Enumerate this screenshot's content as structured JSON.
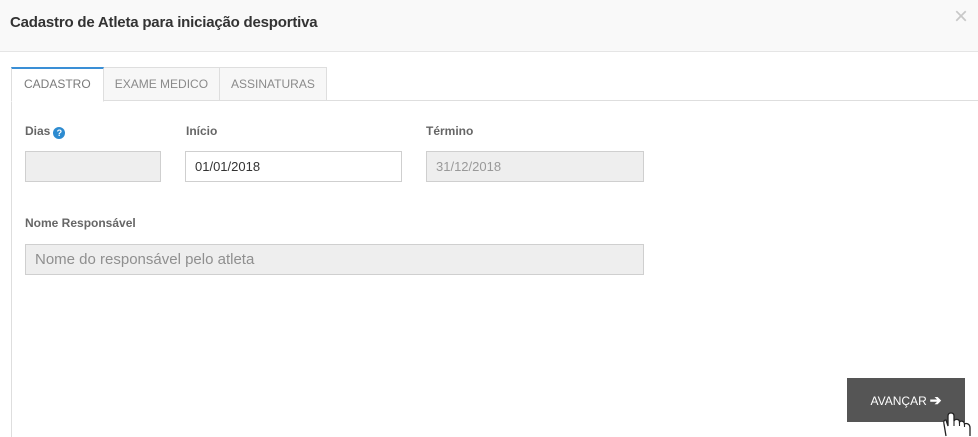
{
  "modal": {
    "title": "Cadastro de Atleta para iniciação desportiva",
    "close_symbol": "×"
  },
  "tabs": [
    {
      "label": "CADASTRO",
      "active": true
    },
    {
      "label": "EXAME MEDICO",
      "active": false
    },
    {
      "label": "ASSINATURAS",
      "active": false
    }
  ],
  "form": {
    "dias": {
      "label": "Dias",
      "value": "",
      "help_icon": "question-circle-icon",
      "help_symbol": "?"
    },
    "inicio": {
      "label": "Início",
      "value": "01/01/2018"
    },
    "termino": {
      "label": "Término",
      "value": "31/12/2018"
    },
    "responsavel": {
      "label": "Nome Responsável",
      "value": "",
      "placeholder": "Nome do responsável pelo atleta"
    }
  },
  "actions": {
    "next_label": "AVANÇAR",
    "next_icon": "arrow-right-icon",
    "next_symbol": "➔"
  },
  "colors": {
    "accent": "#3a8fd6",
    "button_bg": "#555555",
    "readonly_bg": "#eeeeee"
  }
}
